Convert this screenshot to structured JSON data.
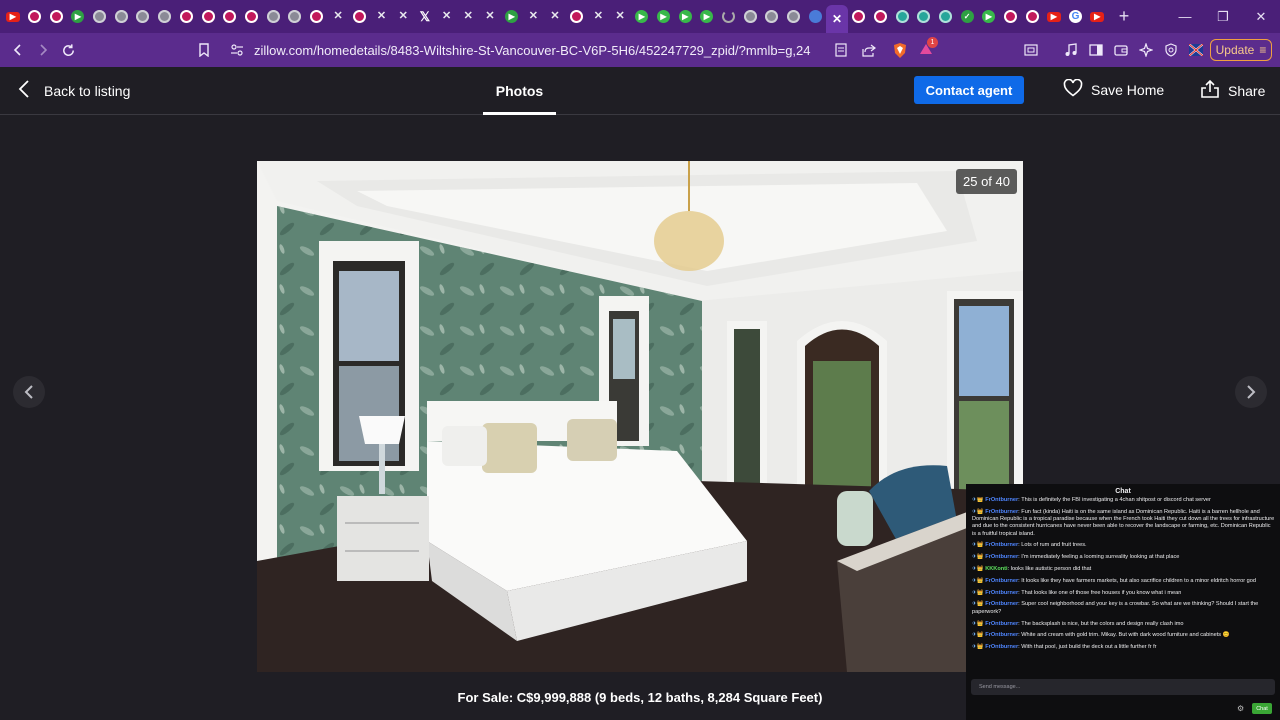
{
  "browser": {
    "tabs": [
      {
        "icon": "youtube-icon",
        "active": false
      },
      {
        "icon": "red-ring-icon",
        "active": false
      },
      {
        "icon": "red-ring-icon",
        "active": false
      },
      {
        "icon": "green-play-circle-icon",
        "active": false
      },
      {
        "icon": "grey-ring-icon",
        "active": false
      },
      {
        "icon": "grey-ring-icon",
        "active": false
      },
      {
        "icon": "grey-ring-icon",
        "active": false
      },
      {
        "icon": "grey-ring-icon",
        "active": false
      },
      {
        "icon": "red-ring-icon",
        "active": false
      },
      {
        "icon": "red-ring-icon",
        "active": false
      },
      {
        "icon": "red-ring-icon",
        "active": false
      },
      {
        "icon": "red-ring-icon",
        "active": false
      },
      {
        "icon": "grey-ring-icon",
        "active": false
      },
      {
        "icon": "grey-ring-icon",
        "active": false
      },
      {
        "icon": "red-ring-icon",
        "active": false
      },
      {
        "icon": "x-icon",
        "active": false
      },
      {
        "icon": "red-ring-icon",
        "active": false
      },
      {
        "icon": "x-icon",
        "active": false
      },
      {
        "icon": "x-icon",
        "active": false
      },
      {
        "icon": "x-logo-icon",
        "active": false
      },
      {
        "icon": "x-icon",
        "active": false
      },
      {
        "icon": "x-icon",
        "active": false
      },
      {
        "icon": "x-icon",
        "active": false
      },
      {
        "icon": "green-play-circle-icon",
        "active": false
      },
      {
        "icon": "x-icon",
        "active": false
      },
      {
        "icon": "x-icon",
        "active": false
      },
      {
        "icon": "red-ring-icon",
        "active": false
      },
      {
        "icon": "x-icon",
        "active": false
      },
      {
        "icon": "x-icon",
        "active": false
      },
      {
        "icon": "play-icon",
        "active": false
      },
      {
        "icon": "play-icon",
        "active": false
      },
      {
        "icon": "play-icon",
        "active": false
      },
      {
        "icon": "play-icon",
        "active": false
      },
      {
        "icon": "loading-icon",
        "active": false
      },
      {
        "icon": "grey-ring-icon",
        "active": false
      },
      {
        "icon": "grey-ring-icon",
        "active": false
      },
      {
        "icon": "grey-ring-icon",
        "active": false
      },
      {
        "icon": "blue-ring-icon",
        "active": false
      },
      {
        "icon": "close-icon",
        "active": true
      },
      {
        "icon": "red-ring-icon",
        "active": false
      },
      {
        "icon": "red-ring-icon",
        "active": false
      },
      {
        "icon": "teal-ring-icon",
        "active": false
      },
      {
        "icon": "teal-ring-icon",
        "active": false
      },
      {
        "icon": "teal-ring-icon",
        "active": false
      },
      {
        "icon": "green-ring-icon",
        "active": false
      },
      {
        "icon": "play-icon",
        "active": false
      },
      {
        "icon": "red-ring-icon",
        "active": false
      },
      {
        "icon": "red-ring-icon",
        "active": false
      },
      {
        "icon": "youtube-icon",
        "active": false
      },
      {
        "icon": "google-icon",
        "active": false
      },
      {
        "icon": "youtube-icon",
        "active": false
      }
    ],
    "url": "zillow.com/homedetails/8483-Wiltshire-St-Vancouver-BC-V6P-5H6/452247729_zpid/?mmlb=g,24",
    "update_label": "Update",
    "brave_badge": "1"
  },
  "header": {
    "back_label": "Back to listing",
    "photos_tab": "Photos",
    "contact_label": "Contact agent",
    "save_label": "Save Home",
    "share_label": "Share"
  },
  "photo": {
    "counter": "25 of 40",
    "caption": "For Sale: C$9,999,888 (9 beds, 12 baths, 8,284 Square Feet)"
  },
  "chat": {
    "title": "Chat",
    "messages": [
      {
        "user": "FrOntburner",
        "text": "This is definitely the FBI investigating a 4chan shitpost or discord chat server"
      },
      {
        "user": "FrOntburner",
        "text": "Fun fact (kinda) Haiti is on the same island as Dominican Republic. Haiti is a barren hellhole and Dominican Republic is a tropical paradise because when the French took Haiti they cut down all the trees for infrastructure and due to the consistent hurricanes have never been able to recover the landscape or farming, etc. Dominican Republic is a fruitful tropical island."
      },
      {
        "user": "FrOntburner",
        "text": "Lots of rum and fruit trees."
      },
      {
        "user": "FrOntburner",
        "text": "I'm immediately feeling a looming surreality looking at that place"
      },
      {
        "user": "KKKonti",
        "text": "looks like autistic person did that"
      },
      {
        "user": "FrOntburner",
        "text": "It looks like they have farmers markets, but also sacrifice children to a minor eldritch horror god"
      },
      {
        "user": "FrOntburner",
        "text": "That looks like one of those free houses if you know what i mean"
      },
      {
        "user": "FrOntburner",
        "text": "Super cool neighborhood and your key is a crowbar. So what are we thinking? Should I start the paperwork?"
      },
      {
        "user": "FrOntburner",
        "text": "The backsplash is nice, but the colors and design really clash imo"
      },
      {
        "user": "FrOntburner",
        "text": "White and cream with gold trim. Mikay. But with dark wood furniture and cabinets 😊"
      },
      {
        "user": "FrOntburner",
        "text": "With that pool, just build the deck out a little further fr fr"
      }
    ],
    "input_placeholder": "Send message...",
    "send_label": "Chat"
  }
}
